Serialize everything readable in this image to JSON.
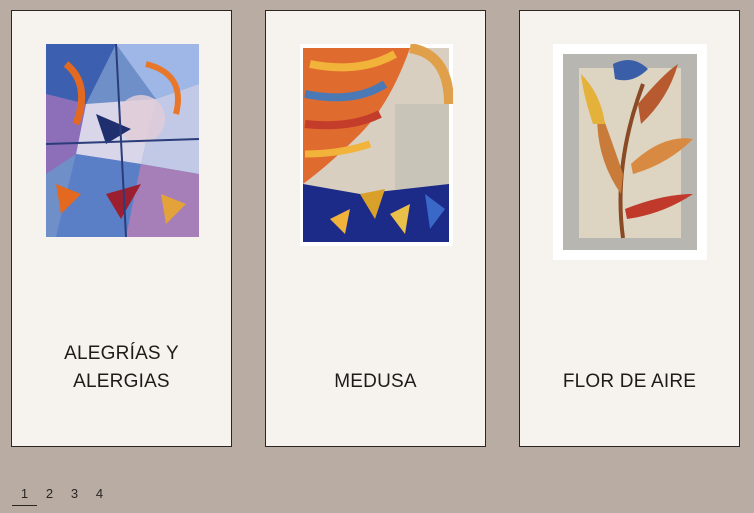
{
  "gallery": {
    "cards": [
      {
        "title": "ALEGRÍAS Y ALERGIAS",
        "image": "abstract-stained-glass-artwork"
      },
      {
        "title": "MEDUSA",
        "image": "colorful-mosaic-artwork"
      },
      {
        "title": "FLOR DE AIRE",
        "image": "flower-mosaic-artwork"
      }
    ]
  },
  "pagination": {
    "pages": [
      "1",
      "2",
      "3",
      "4"
    ],
    "current": "1"
  },
  "colors": {
    "background": "#b8aca3",
    "card": "#f6f3ef",
    "text": "#1e1b18"
  }
}
